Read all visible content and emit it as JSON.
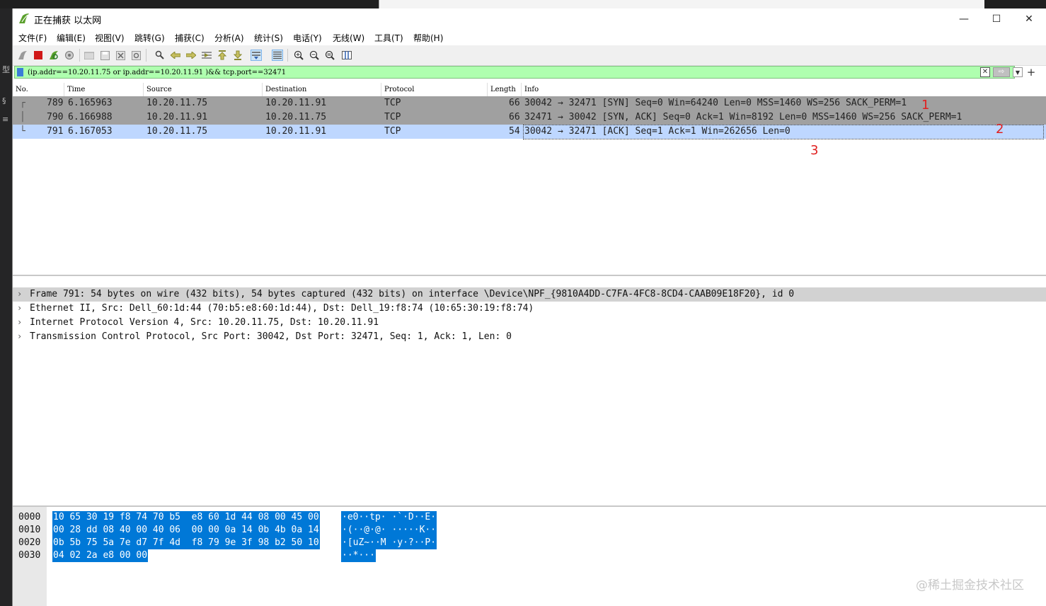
{
  "window": {
    "title": "正在捕获 以太网",
    "controls": {
      "minimize": "—",
      "maximize": "☐",
      "close": "✕"
    }
  },
  "menu": [
    "文件(F)",
    "编辑(E)",
    "视图(V)",
    "跳转(G)",
    "捕获(C)",
    "分析(A)",
    "统计(S)",
    "电话(Y)",
    "无线(W)",
    "工具(T)",
    "帮助(H)"
  ],
  "filter": {
    "value": "(ip.addr==10.20.11.75 or ip.addr==10.20.11.91 )&& tcp.port==32471",
    "clear_glyph": "✕",
    "apply_glyph": "⇨",
    "dropdown_glyph": "▼",
    "add_glyph": "+"
  },
  "columns": [
    "No.",
    "Time",
    "Source",
    "Destination",
    "Protocol",
    "Length",
    "Info"
  ],
  "packets": [
    {
      "no": "789",
      "time": "6.165963",
      "source": "10.20.11.75",
      "destination": "10.20.11.91",
      "protocol": "TCP",
      "length": "66",
      "info": "30042 → 32471 [SYN] Seq=0 Win=64240 Len=0 MSS=1460 WS=256 SACK_PERM=1",
      "state": "gray"
    },
    {
      "no": "790",
      "time": "6.166988",
      "source": "10.20.11.91",
      "destination": "10.20.11.75",
      "protocol": "TCP",
      "length": "66",
      "info": "32471 → 30042 [SYN, ACK] Seq=0 Ack=1 Win=8192 Len=0 MSS=1460 WS=256 SACK_PERM=1",
      "state": "gray"
    },
    {
      "no": "791",
      "time": "6.167053",
      "source": "10.20.11.75",
      "destination": "10.20.11.91",
      "protocol": "TCP",
      "length": "54",
      "info": "30042 → 32471 [ACK] Seq=1 Ack=1 Win=262656 Len=0",
      "state": "selected"
    }
  ],
  "annotations": [
    "1",
    "2",
    "3"
  ],
  "details": [
    "Frame 791: 54 bytes on wire (432 bits), 54 bytes captured (432 bits) on interface \\Device\\NPF_{9810A4DD-C7FA-4FC8-8CD4-CAAB09E18F20}, id 0",
    "Ethernet II, Src: Dell_60:1d:44 (70:b5:e8:60:1d:44), Dst: Dell_19:f8:74 (10:65:30:19:f8:74)",
    "Internet Protocol Version 4, Src: 10.20.11.75, Dst: 10.20.11.91",
    "Transmission Control Protocol, Src Port: 30042, Dst Port: 32471, Seq: 1, Ack: 1, Len: 0"
  ],
  "detail_chevron": "›",
  "bytes": [
    {
      "offset": "0000",
      "hex": "10 65 30 19 f8 74 70 b5  e8 60 1d 44 08 00 45 00",
      "ascii": "·e0··tp· ·`·D··E·"
    },
    {
      "offset": "0010",
      "hex": "00 28 dd 08 40 00 40 06  00 00 0a 14 0b 4b 0a 14",
      "ascii": "·(··@·@· ·····K··"
    },
    {
      "offset": "0020",
      "hex": "0b 5b 75 5a 7e d7 7f 4d  f8 79 9e 3f 98 b2 50 10",
      "ascii": "·[uZ~··M ·y·?··P·"
    },
    {
      "offset": "0030",
      "hex": "04 02 2a e8 00 00",
      "ascii": "··*···"
    }
  ],
  "watermark": "@稀土掘金技术社区",
  "colors": {
    "filter_bg": "#afffaf",
    "selected_row": "#bed7ff",
    "gray_row": "#a0a0a0",
    "byte_highlight": "#0078d7",
    "annotation": "#e02020"
  }
}
